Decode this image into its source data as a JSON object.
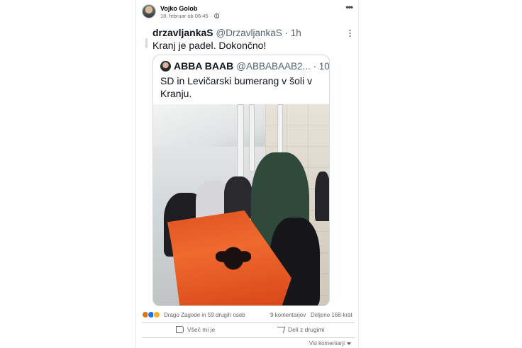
{
  "post": {
    "author": "Vojko Golob",
    "date": "18. februar ob 06:45",
    "privacy_icon": "globe-icon",
    "menu_icon": "more-icon"
  },
  "tweet": {
    "name": "drzavljankaS",
    "handle": "@DrzavljankaS · 1h",
    "text": "Kranj je padel. Dokončno!",
    "quote": {
      "name": "ABBA BAAB",
      "handle": "@ABBABAAB2... · 10h",
      "text": "SD in Levičarski bumerang v šoli v Kranju."
    }
  },
  "stats": {
    "reactions": [
      "angry",
      "like",
      "haha"
    ],
    "reactors": "Drago Zagode in 59 drugih oseb",
    "comments": "9 komentarjev",
    "shares": "Deljeno 168-krat"
  },
  "actions": {
    "like_label": "Všeč mi je",
    "share_label": "Deli z drugimi"
  },
  "comments": {
    "sort_label": "Vsi komentarji"
  },
  "colors": {
    "text_primary": "#050505",
    "text_secondary": "#65676b",
    "like_blue": "#1877f2",
    "flag_red": "#e0521f"
  }
}
